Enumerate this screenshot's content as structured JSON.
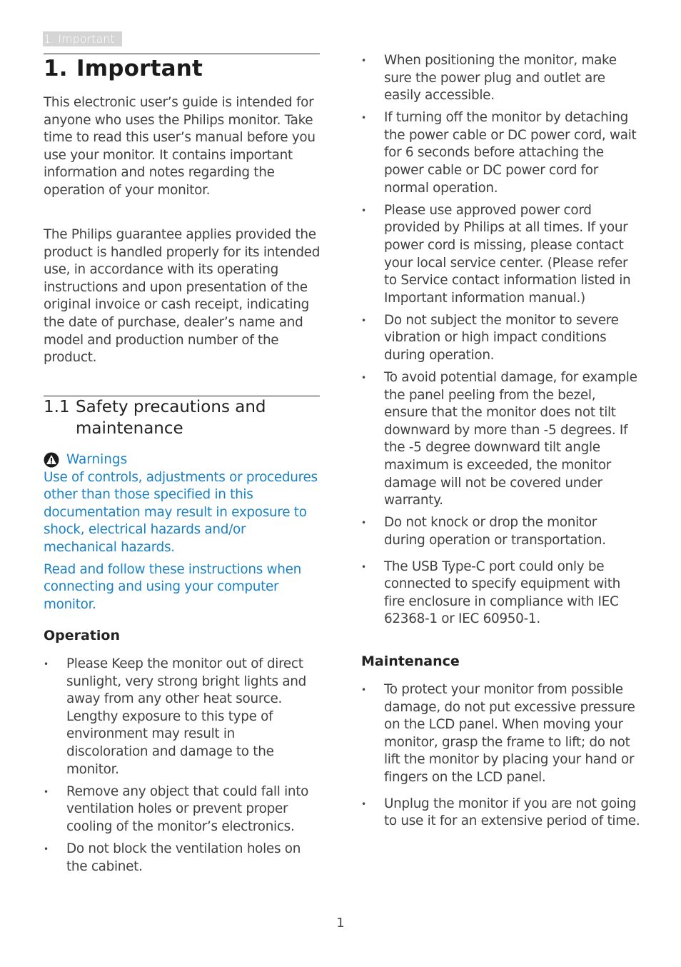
{
  "running_head": "1. Important",
  "chapter": {
    "number": "1.",
    "title": "Important"
  },
  "intro_paragraphs": [
    "This electronic user’s guide is intended for anyone who uses the Philips monitor. Take time to read this user’s manual before you use your monitor. It contains important information and notes regarding the operation of your monitor.",
    "The Philips guarantee applies provided the product is handled properly for its intended use, in accordance with its operating instructions and upon presentation of the original invoice or cash receipt, indicating the date of purchase, dealer’s name and model and production number of the product."
  ],
  "section": {
    "number": "1.1",
    "title": "Safety precautions and maintenance"
  },
  "warnings": {
    "icon": "warning-triangle-icon",
    "heading": "Warnings",
    "color": "#1a82c4",
    "paragraphs": [
      "Use of controls, adjustments or procedures other than those specified in this documentation may result in exposure to shock, electrical hazards and/or mechanical hazards.",
      "Read and follow these instructions when connecting and using your computer monitor."
    ]
  },
  "operation": {
    "heading": "Operation",
    "items_left": [
      "Please Keep the monitor out of direct sunlight, very strong bright lights and away from any other heat source. Lengthy exposure to this type of environment may result in discoloration and damage to the monitor.",
      "Remove any object that could fall into ventilation holes or prevent proper cooling of the monitor’s electronics.",
      "Do not block the ventilation holes on the cabinet."
    ],
    "items_right": [
      "When positioning the monitor, make sure the power plug and outlet are easily accessible.",
      "If turning off the monitor by detaching the power cable or DC power cord, wait for 6 seconds before attaching the power cable or DC power cord for normal operation.",
      "Please use approved power cord provided by Philips at all times. If your power cord is missing, please contact your local service center. (Please refer to Service contact information listed in Important information manual.)",
      "Do not subject the monitor to severe vibration or high impact conditions during operation.",
      "To avoid potential damage, for example the panel peeling from the bezel, ensure that the monitor does not tilt downward by more than -5 degrees. If the -5 degree downward tilt angle maximum is exceeded, the monitor damage will not be covered under warranty.",
      "Do not knock or drop the monitor during operation or transportation.",
      "The USB Type-C port could only be connected to specify equipment with fire enclosure in compliance with IEC 62368-1 or IEC 60950-1."
    ]
  },
  "maintenance": {
    "heading": "Maintenance",
    "items": [
      "To protect your monitor from possible damage, do not put excessive pressure on the LCD panel. When moving your monitor, grasp the frame to lift; do not lift the monitor by placing your hand or fingers on the LCD panel.",
      "Unplug the monitor if you are not going to use it for an extensive period of time."
    ]
  },
  "bullet": "•",
  "page_number": "1"
}
